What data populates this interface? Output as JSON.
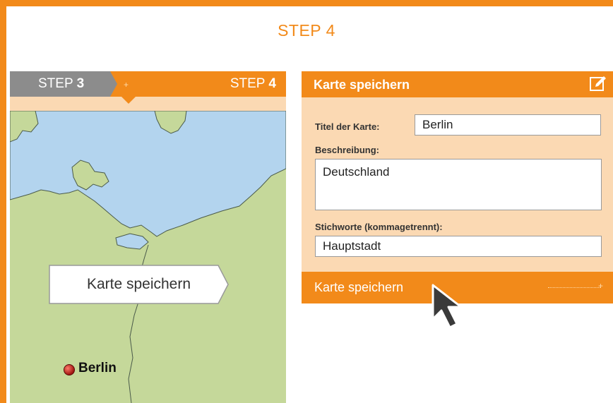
{
  "page": {
    "title": "STEP 4"
  },
  "steps": {
    "step3_prefix": "STEP ",
    "step3_num": "3",
    "step4_prefix": "STEP ",
    "step4_num": "4"
  },
  "map": {
    "button_label": "Karte speichern",
    "city": "Berlin"
  },
  "form": {
    "title": "Karte speichern",
    "title_label": "Titel der Karte:",
    "title_value": "Berlin",
    "description_label": "Beschreibung:",
    "description_value": "Deutschland",
    "keywords_label": "Stichworte (kommagetrennt):",
    "keywords_value": "Hauptstadt",
    "submit_label": "Karte speichern"
  },
  "icons": {
    "edit": "pencil-edit-icon",
    "cursor": "mouse-pointer-icon"
  },
  "colors": {
    "accent": "#f28a1a",
    "panel": "#fbd9b3",
    "tab_inactive": "#8c8c8c",
    "water": "#b3d4ee",
    "land": "#c5d89a"
  }
}
